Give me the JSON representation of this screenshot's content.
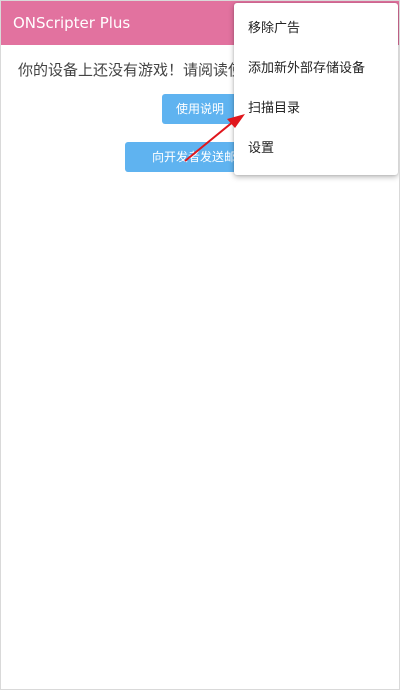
{
  "app_bar": {
    "title": "ONScripter Plus",
    "color": "#e2729f"
  },
  "main": {
    "notice": "你的设备上还没有游戏！请阅读使",
    "manual_button": "使用说明",
    "email_button": "向开发者发送邮件"
  },
  "overflow_menu": {
    "items": [
      {
        "label": "移除广告"
      },
      {
        "label": "添加新外部存储设备"
      },
      {
        "label": "扫描目录"
      },
      {
        "label": "设置"
      }
    ]
  },
  "annotation": {
    "arrow_color": "#e0161c",
    "points_to": "扫描目录"
  },
  "colors": {
    "button": "#5fb3f0",
    "background": "#ffffff"
  }
}
